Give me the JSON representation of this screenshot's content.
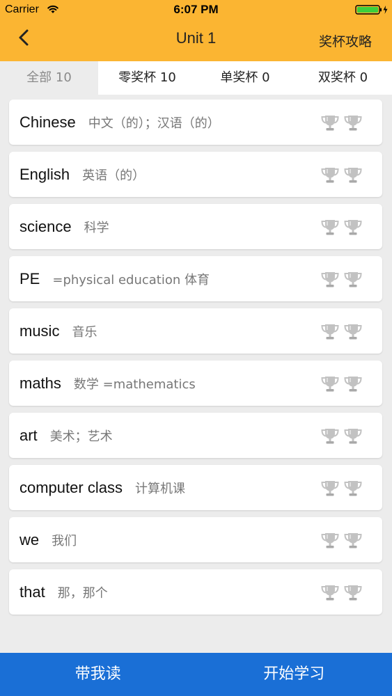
{
  "status_bar": {
    "carrier": "Carrier",
    "time": "6:07 PM"
  },
  "nav": {
    "title": "Unit 1",
    "right_button": "奖杯攻略",
    "back_icon": "chevron-left-icon"
  },
  "tabs": [
    {
      "label": "全部 10",
      "active": true
    },
    {
      "label": "零奖杯 10",
      "active": false
    },
    {
      "label": "单奖杯 0",
      "active": false
    },
    {
      "label": "双奖杯 0",
      "active": false
    }
  ],
  "words": [
    {
      "en": "Chinese",
      "cn": "中文（的）；汉语（的）"
    },
    {
      "en": "English",
      "cn": "英语（的）"
    },
    {
      "en": "science",
      "cn": "科学"
    },
    {
      "en": "PE",
      "cn": "=physical education 体育"
    },
    {
      "en": "music",
      "cn": "音乐"
    },
    {
      "en": "maths",
      "cn": "数学 =mathematics"
    },
    {
      "en": "art",
      "cn": "美术；艺术"
    },
    {
      "en": "computer class",
      "cn": "计算机课"
    },
    {
      "en": "we",
      "cn": "我们"
    },
    {
      "en": "that",
      "cn": "那，那个"
    }
  ],
  "bottom": {
    "read_with_me": "带我读",
    "start_learning": "开始学习"
  },
  "colors": {
    "header": "#fbb532",
    "bottom_bar": "#1a6fd6",
    "background": "#ececec",
    "trophy_inactive": "#b9b9b9"
  }
}
